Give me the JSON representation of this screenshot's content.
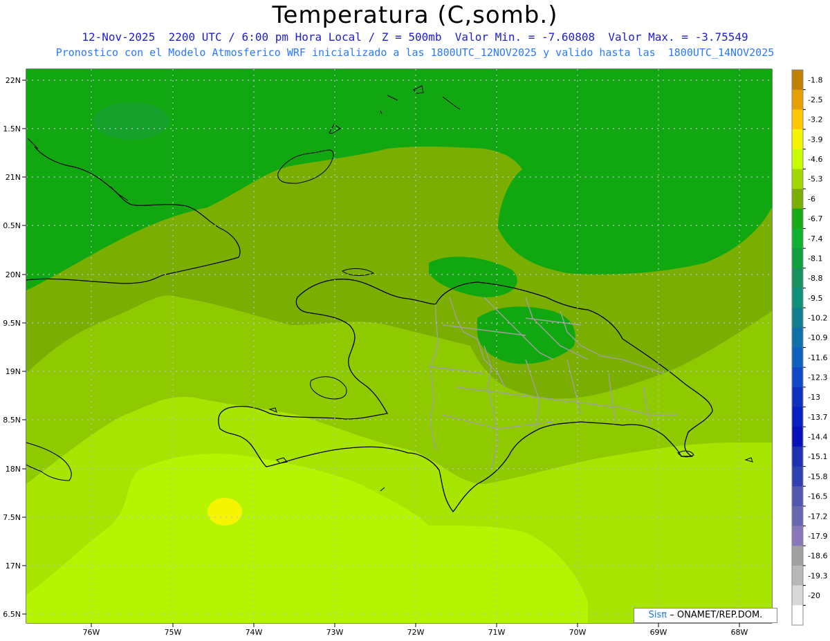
{
  "header": {
    "title": "Temperatura (C,somb.)",
    "subtitle1": "12-Nov-2025  2200 UTC / 6:00 pm Hora Local / Z = 500mb  Valor Min. = -7.60808  Valor Max. = -3.75549",
    "subtitle2": "Pronostico con el Modelo Atmosferico WRF inicializado a las 1800UTC_12NOV2025 y valido hasta las  1800UTC_14NOV2025"
  },
  "axes": {
    "lat_labels": [
      "22N",
      "1.5N",
      "21N",
      "0.5N",
      "20N",
      "9.5N",
      "19N",
      "8.5N",
      "18N",
      "7.5N",
      "17N",
      "6.5N"
    ],
    "lon_labels": [
      "76W",
      "75W",
      "74W",
      "73W",
      "72W",
      "71W",
      "70W",
      "69W",
      "68W"
    ]
  },
  "colorbar": {
    "labels": [
      "-1.8",
      "-2.5",
      "-3.2",
      "-3.9",
      "-4.6",
      "-5.3",
      "-6",
      "-6.7",
      "-7.4",
      "-8.1",
      "-8.8",
      "-9.5",
      "-10.2",
      "-10.9",
      "-11.6",
      "-12.3",
      "-13",
      "-13.7",
      "-14.4",
      "-15.1",
      "-15.8",
      "-16.5",
      "-17.2",
      "-17.9",
      "-18.6",
      "-19.3",
      "-20"
    ],
    "colors": [
      "#c08000",
      "#e6a000",
      "#ffc800",
      "#f5f500",
      "#c8ff00",
      "#a0d800",
      "#7aae00",
      "#18a818",
      "#10b030",
      "#10a040",
      "#189060",
      "#10907a",
      "#108090",
      "#1070a8",
      "#1060c0",
      "#1048c8",
      "#1030c0",
      "#0820c0",
      "#0a10b8",
      "#2030b0",
      "#3040b0",
      "#5058b0",
      "#6868b0",
      "#8878b8",
      "#a0a0a0",
      "#b8b8b8",
      "#d8d8d8",
      "#ffffff"
    ]
  },
  "credit": {
    "brand": "Sisπ",
    "text": "– ONAMET/REP.DOM."
  },
  "map_colors": {
    "band_cold": "#11a711",
    "band_mid_dark": "#7aae00",
    "band_mid": "#8fca00",
    "band_light": "#a7e400",
    "band_warm": "#b5f500",
    "warm_spot": "#f5f500",
    "coast": "#000000",
    "borders": "#a0a0a0"
  }
}
